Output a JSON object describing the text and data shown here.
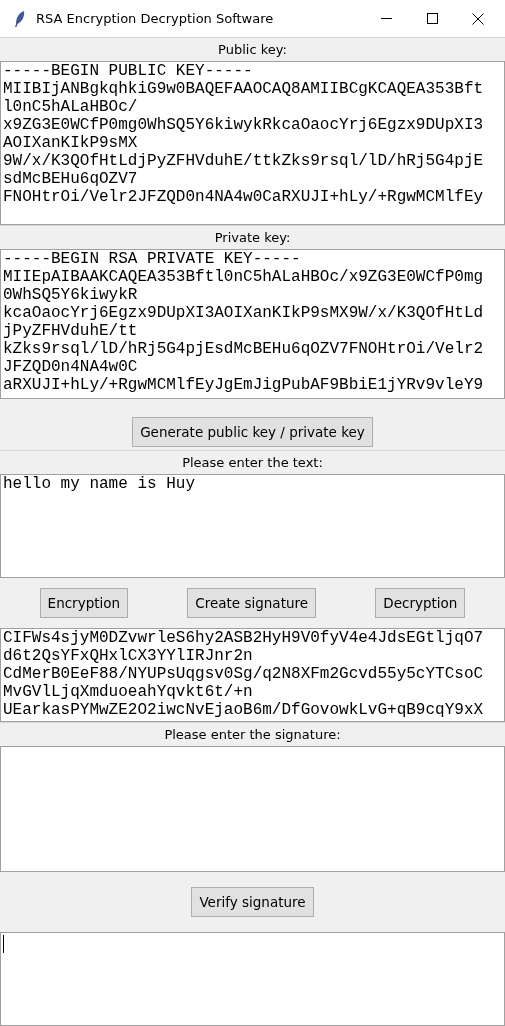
{
  "window": {
    "title": "RSA Encryption Decryption Software"
  },
  "public_key": {
    "label": "Public key:",
    "lines": [
      "-----BEGIN PUBLIC KEY-----",
      "MIIBIjANBgkqhkiG9w0BAQEFAAOCAQ8AMIIBCgKCAQEA353Bft",
      "l0nC5hALaHBOc/",
      "x9ZG3E0WCfP0mg0WhSQ5Y6kiwykRkcaOaocYrj6Egzx9DUpXI3",
      "AOIXanKIkP9sMX",
      "9W/x/K3QOfHtLdjPyZFHVduhE/ttkZks9rsql/lD/hRj5G4pjE",
      "sdMcBEHu6qOZV7",
      "FNOHtrOi/Velr2JFZQD0n4NA4w0CaRXUJI+hLy/+RgwMCMlfEy"
    ]
  },
  "private_key": {
    "label": "Private key:",
    "lines": [
      "-----BEGIN RSA PRIVATE KEY-----",
      "MIIEpAIBAAKCAQEA353Bftl0nC5hALaHBOc/x9ZG3E0WCfP0mg",
      "0WhSQ5Y6kiwykR",
      "kcaOaocYrj6Egzx9DUpXI3AOIXanKIkP9sMX9W/x/K3QOfHtLd",
      "jPyZFHVduhE/tt",
      "kZks9rsql/lD/hRj5G4pjEsdMcBEHu6qOZV7FNOHtrOi/Velr2",
      "JFZQD0n4NA4w0C",
      "aRXUJI+hLy/+RgwMCMlfEyJgEmJigPubAF9BbiE1jYRv9vleY9"
    ]
  },
  "generate_button": "Generate public key / private key",
  "text_input": {
    "label": "Please enter the text:",
    "value": "hello my name is Huy"
  },
  "buttons": [
    "Encryption",
    "Create signature",
    "Decryption"
  ],
  "output": {
    "lines": [
      "CIFWs4sjyM0DZvwrleS6hy2ASB2HyH9V0fyV4e4JdsEGtljqO7",
      "d6t2QsYFxQHxlCX3YYlIRJnr2n",
      "CdMerB0EeF88/NYUPsUqgsv0Sg/q2N8XFm2Gcvd55y5cYTCsoC",
      "MvGVlLjqXmduoeahYqvkt6t/+n",
      "UEarkasPYMwZE2O2iwcNvEjaoB6m/DfGovowkLvG+qB9cqY9xX"
    ]
  },
  "signature_input": {
    "label": "Please enter the signature:"
  },
  "verify_button": "Verify signature"
}
